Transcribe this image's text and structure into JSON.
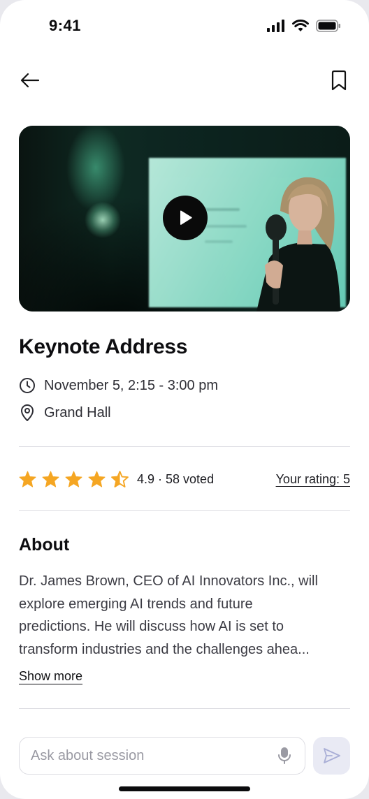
{
  "status_bar": {
    "time": "9:41"
  },
  "session": {
    "title": "Keynote Address",
    "datetime": "November 5, 2:15 - 3:00 pm",
    "location": "Grand Hall"
  },
  "rating": {
    "stars": 4.5,
    "text": "4.9 · 58 voted",
    "your_rating": "Your rating: 5",
    "star_color": "#F5A623"
  },
  "about": {
    "heading": "About",
    "line1": "Dr. James Brown, CEO of AI Innovators Inc., will",
    "line2": "explore emerging AI trends and future",
    "line3": "predictions. He will discuss how AI is set to",
    "line4": "transform industries and the challenges ahea...",
    "show_more": "Show more"
  },
  "composer": {
    "placeholder": "Ask about session"
  },
  "icons": {
    "back": "arrow-left-icon",
    "bookmark": "bookmark-icon",
    "play": "play-icon",
    "clock": "clock-icon",
    "location": "map-pin-icon",
    "mic": "microphone-icon",
    "send": "send-icon"
  }
}
